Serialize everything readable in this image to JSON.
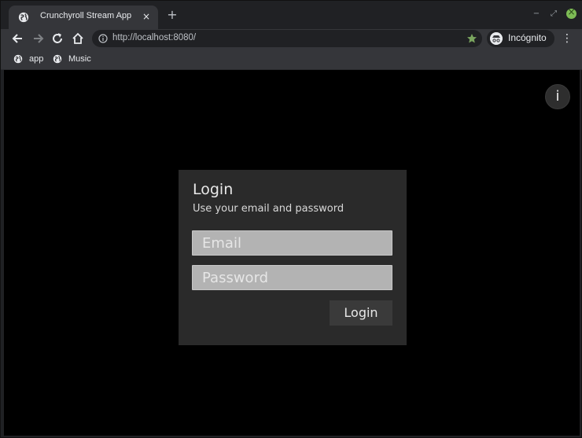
{
  "browser": {
    "tab": {
      "title": "Crunchyroll Stream App",
      "close_glyph": "×",
      "favicon": "globe-icon"
    },
    "new_tab_glyph": "+",
    "window_controls": {
      "minimize": "−",
      "restore": "⤢",
      "close_color": "#7dbb55"
    },
    "toolbar": {
      "back_icon": "arrow-left-icon",
      "forward_icon": "arrow-right-icon",
      "reload_icon": "reload-icon",
      "home_icon": "home-icon",
      "url": "http://localhost:8080/",
      "star_icon": "star-icon",
      "profile_label": "Incógnito",
      "menu_glyph": "⋮"
    },
    "bookmarks": [
      {
        "label": "app",
        "icon": "globe-icon"
      },
      {
        "label": "Music",
        "icon": "globe-icon"
      }
    ]
  },
  "page": {
    "info_button": "i",
    "login": {
      "title": "Login",
      "subtitle": "Use your email and password",
      "email_placeholder": "Email",
      "email_value": "",
      "password_placeholder": "Password",
      "password_value": "",
      "submit_label": "Login"
    },
    "colors": {
      "background": "#000000",
      "card": "#2a2a2a",
      "input": "#b3b3b3",
      "button": "#3a3a3a"
    }
  }
}
